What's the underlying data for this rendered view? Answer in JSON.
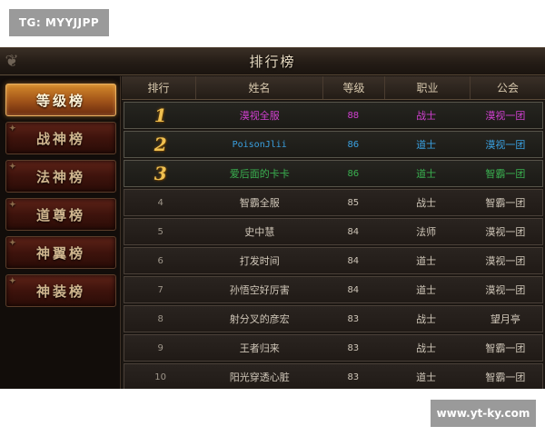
{
  "watermarks": {
    "top_left": "TG: MYYJJPP",
    "bottom_right": "www.yt-ky.com"
  },
  "window": {
    "title": "排行榜"
  },
  "sidebar": {
    "items": [
      {
        "label": "等级榜",
        "active": true
      },
      {
        "label": "战神榜",
        "active": false
      },
      {
        "label": "法神榜",
        "active": false
      },
      {
        "label": "道尊榜",
        "active": false
      },
      {
        "label": "神翼榜",
        "active": false
      },
      {
        "label": "神装榜",
        "active": false
      }
    ]
  },
  "table": {
    "headers": [
      "排行",
      "姓名",
      "等级",
      "职业",
      "公会"
    ],
    "rows": [
      {
        "rank": "1",
        "name": "漠视全服",
        "level": "88",
        "class": "战士",
        "guild": "漠视一团",
        "color": "#d040d0"
      },
      {
        "rank": "2",
        "name": "PoisonJlii",
        "level": "86",
        "class": "道士",
        "guild": "漠视一团",
        "color": "#3aa0e0"
      },
      {
        "rank": "3",
        "name": "爱后面的卡卡",
        "level": "86",
        "class": "道士",
        "guild": "智霸一团",
        "color": "#3ab050"
      },
      {
        "rank": "4",
        "name": "智霸全服",
        "level": "85",
        "class": "战士",
        "guild": "智霸一团",
        "color": "#d0c8bb"
      },
      {
        "rank": "5",
        "name": "史中慧",
        "level": "84",
        "class": "法师",
        "guild": "漠视一团",
        "color": "#d0c8bb"
      },
      {
        "rank": "6",
        "name": "打发时间",
        "level": "84",
        "class": "道士",
        "guild": "漠视一团",
        "color": "#d0c8bb"
      },
      {
        "rank": "7",
        "name": "孙悟空好厉害",
        "level": "84",
        "class": "道士",
        "guild": "漠视一团",
        "color": "#d0c8bb"
      },
      {
        "rank": "8",
        "name": "射分叉的彦宏",
        "level": "83",
        "class": "战士",
        "guild": "望月亭",
        "color": "#d0c8bb"
      },
      {
        "rank": "9",
        "name": "王者归来",
        "level": "83",
        "class": "战士",
        "guild": "智霸一团",
        "color": "#d0c8bb"
      },
      {
        "rank": "10",
        "name": "阳光穿透心脏",
        "level": "83",
        "class": "道士",
        "guild": "智霸一团",
        "color": "#d0c8bb"
      }
    ]
  }
}
